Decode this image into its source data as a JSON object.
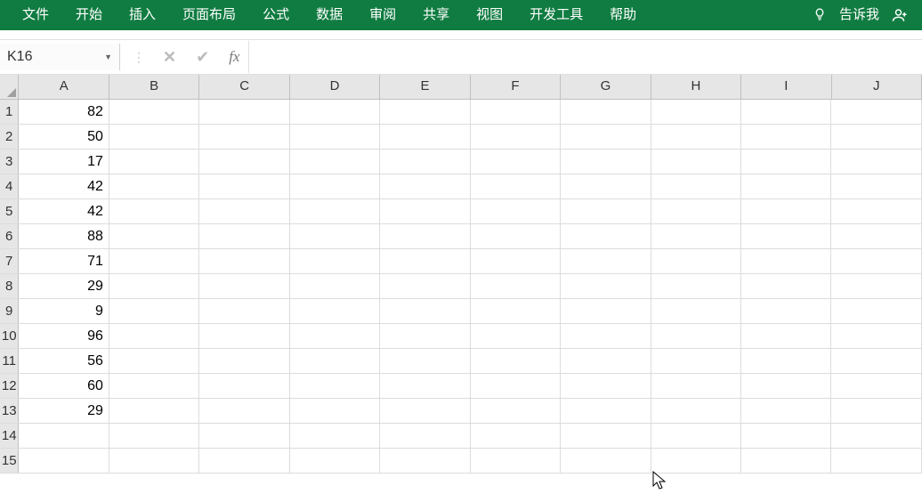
{
  "ribbon": {
    "tabs": [
      "文件",
      "开始",
      "插入",
      "页面布局",
      "公式",
      "数据",
      "审阅",
      "共享",
      "视图",
      "开发工具",
      "帮助"
    ],
    "tellme": "告诉我"
  },
  "namebox": {
    "value": "K16"
  },
  "formula_bar": {
    "value": ""
  },
  "columns": [
    "A",
    "B",
    "C",
    "D",
    "E",
    "F",
    "G",
    "H",
    "I",
    "J"
  ],
  "rows": [
    {
      "n": "1",
      "A": "82"
    },
    {
      "n": "2",
      "A": "50"
    },
    {
      "n": "3",
      "A": "17"
    },
    {
      "n": "4",
      "A": "42"
    },
    {
      "n": "5",
      "A": "42"
    },
    {
      "n": "6",
      "A": "88"
    },
    {
      "n": "7",
      "A": "71"
    },
    {
      "n": "8",
      "A": "29"
    },
    {
      "n": "9",
      "A": "9"
    },
    {
      "n": "10",
      "A": "96"
    },
    {
      "n": "11",
      "A": "56"
    },
    {
      "n": "12",
      "A": "60"
    },
    {
      "n": "13",
      "A": "29"
    },
    {
      "n": "14",
      "A": ""
    },
    {
      "n": "15",
      "A": ""
    }
  ]
}
